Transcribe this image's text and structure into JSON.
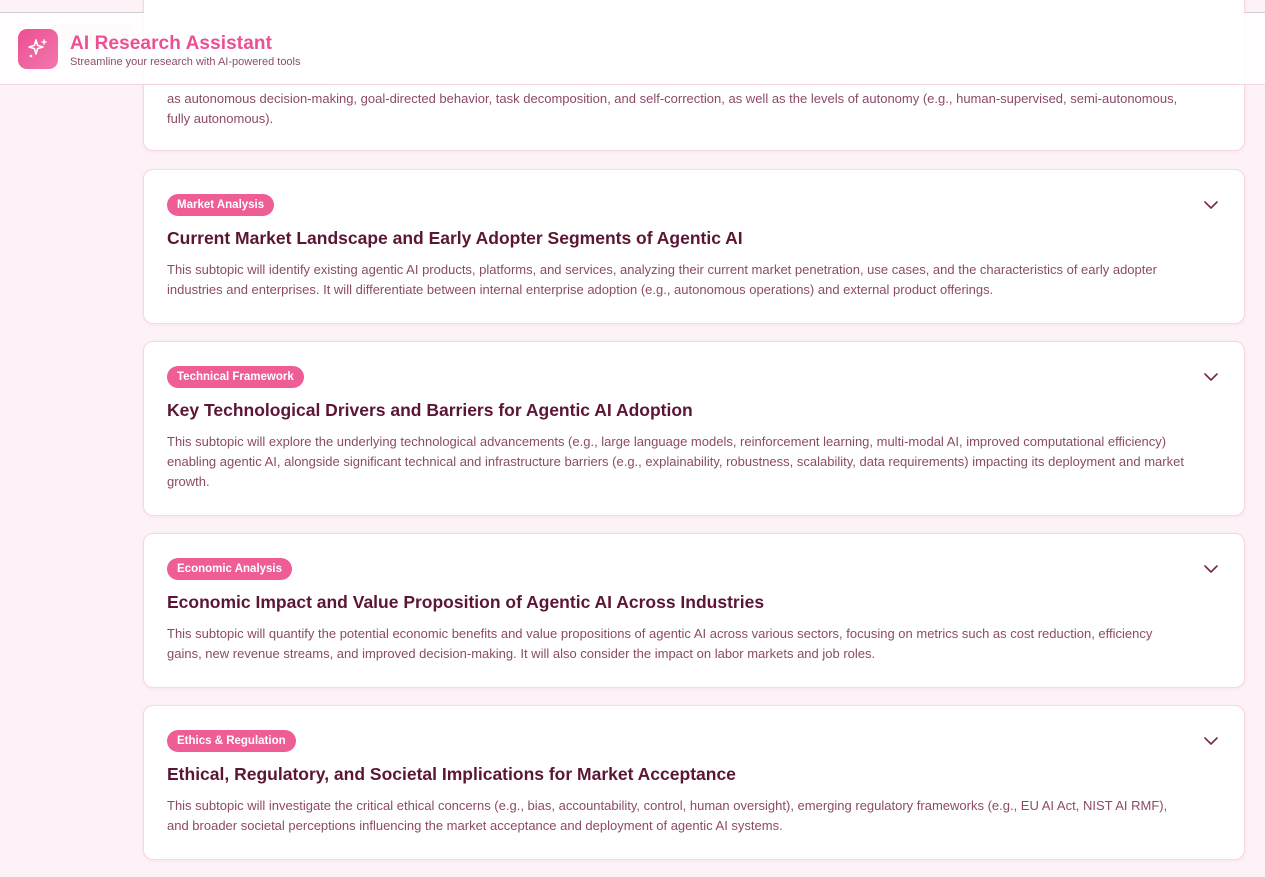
{
  "header": {
    "title": "AI Research Assistant",
    "subtitle": "Streamline your research with AI-powered tools",
    "logo_icon": "sparkles-icon"
  },
  "colors": {
    "accent": "#ec4f93",
    "tag_bg": "#ef5d97",
    "page_bg": "#fdf2f7",
    "title_text": "#5b1635",
    "body_text": "#8c4a68"
  },
  "subtopics": [
    {
      "description_partial": "as autonomous decision-making, goal-directed behavior, task decomposition, and self-correction, as well as the levels of autonomy (e.g., human-supervised, semi-autonomous, fully autonomous)."
    },
    {
      "tag": "Market Analysis",
      "title": "Current Market Landscape and Early Adopter Segments of Agentic AI",
      "description": "This subtopic will identify existing agentic AI products, platforms, and services, analyzing their current market penetration, use cases, and the characteristics of early adopter industries and enterprises. It will differentiate between internal enterprise adoption (e.g., autonomous operations) and external product offerings."
    },
    {
      "tag": "Technical Framework",
      "title": "Key Technological Drivers and Barriers for Agentic AI Adoption",
      "description": "This subtopic will explore the underlying technological advancements (e.g., large language models, reinforcement learning, multi-modal AI, improved computational efficiency) enabling agentic AI, alongside significant technical and infrastructure barriers (e.g., explainability, robustness, scalability, data requirements) impacting its deployment and market growth."
    },
    {
      "tag": "Economic Analysis",
      "title": "Economic Impact and Value Proposition of Agentic AI Across Industries",
      "description": "This subtopic will quantify the potential economic benefits and value propositions of agentic AI across various sectors, focusing on metrics such as cost reduction, efficiency gains, new revenue streams, and improved decision-making. It will also consider the impact on labor markets and job roles."
    },
    {
      "tag": "Ethics & Regulation",
      "title": "Ethical, Regulatory, and Societal Implications for Market Acceptance",
      "description": "This subtopic will investigate the critical ethical concerns (e.g., bias, accountability, control, human oversight), emerging regulatory frameworks (e.g., EU AI Act, NIST AI RMF), and broader societal perceptions influencing the market acceptance and deployment of agentic AI systems."
    }
  ]
}
